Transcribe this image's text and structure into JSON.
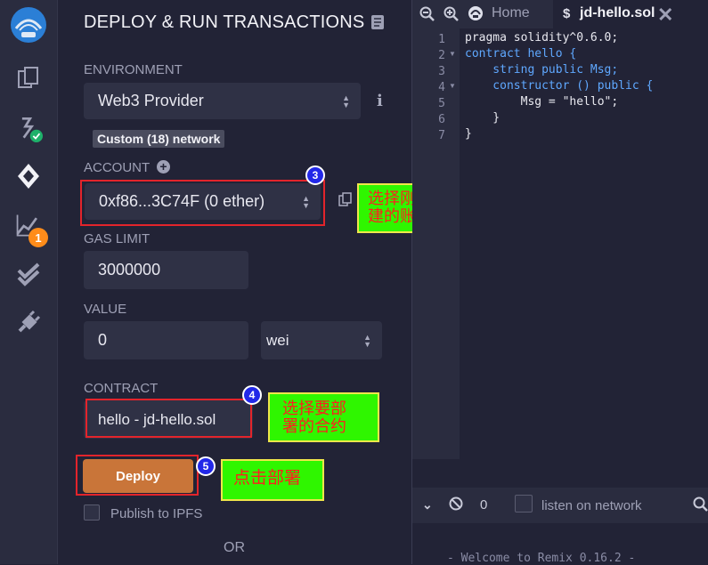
{
  "panel": {
    "title": "DEPLOY & RUN TRANSACTIONS",
    "environment_label": "ENVIRONMENT",
    "environment_value": "Web3 Provider",
    "network_badge": "Custom (18) network",
    "account_label": "ACCOUNT",
    "account_value": "0xf86...3C74F (0 ether)",
    "gas_label": "GAS LIMIT",
    "gas_value": "3000000",
    "value_label": "VALUE",
    "value_amount": "0",
    "value_unit": "wei",
    "contract_label": "CONTRACT",
    "contract_value": "hello - jd-hello.sol",
    "deploy_label": "Deploy",
    "publish_label": "Publish to IPFS",
    "or_label": "OR"
  },
  "rail": {
    "badge_count": "1"
  },
  "annotations": {
    "a3_num": "3",
    "a3_text_line1": "选择刚才创",
    "a3_text_line2": "建的账号",
    "a4_num": "4",
    "a4_text_line1": "选择要部",
    "a4_text_line2": "署的合约",
    "a5_num": "5",
    "a5_text": "点击部署"
  },
  "editor": {
    "tab_home": "Home",
    "tab_file": "jd-hello.sol",
    "line_numbers": [
      "1",
      "2",
      "3",
      "4",
      "5",
      "6",
      "7"
    ],
    "code_lines": [
      "pragma solidity^0.6.0;",
      "contract hello {",
      "    string public Msg;",
      "    constructor () public {",
      "        Msg = \"hello\";",
      "    }",
      "}"
    ]
  },
  "terminal": {
    "count": "0",
    "listen_label": "listen on network",
    "welcome": "- Welcome to Remix 0.16.2 -"
  },
  "colors": {
    "accent_orange": "#c97539",
    "annotation_green": "#2ff600",
    "annotation_red_text": "#ff1e1e",
    "check_green": "#1eb16a",
    "badge_orange": "#ff8c1a"
  }
}
